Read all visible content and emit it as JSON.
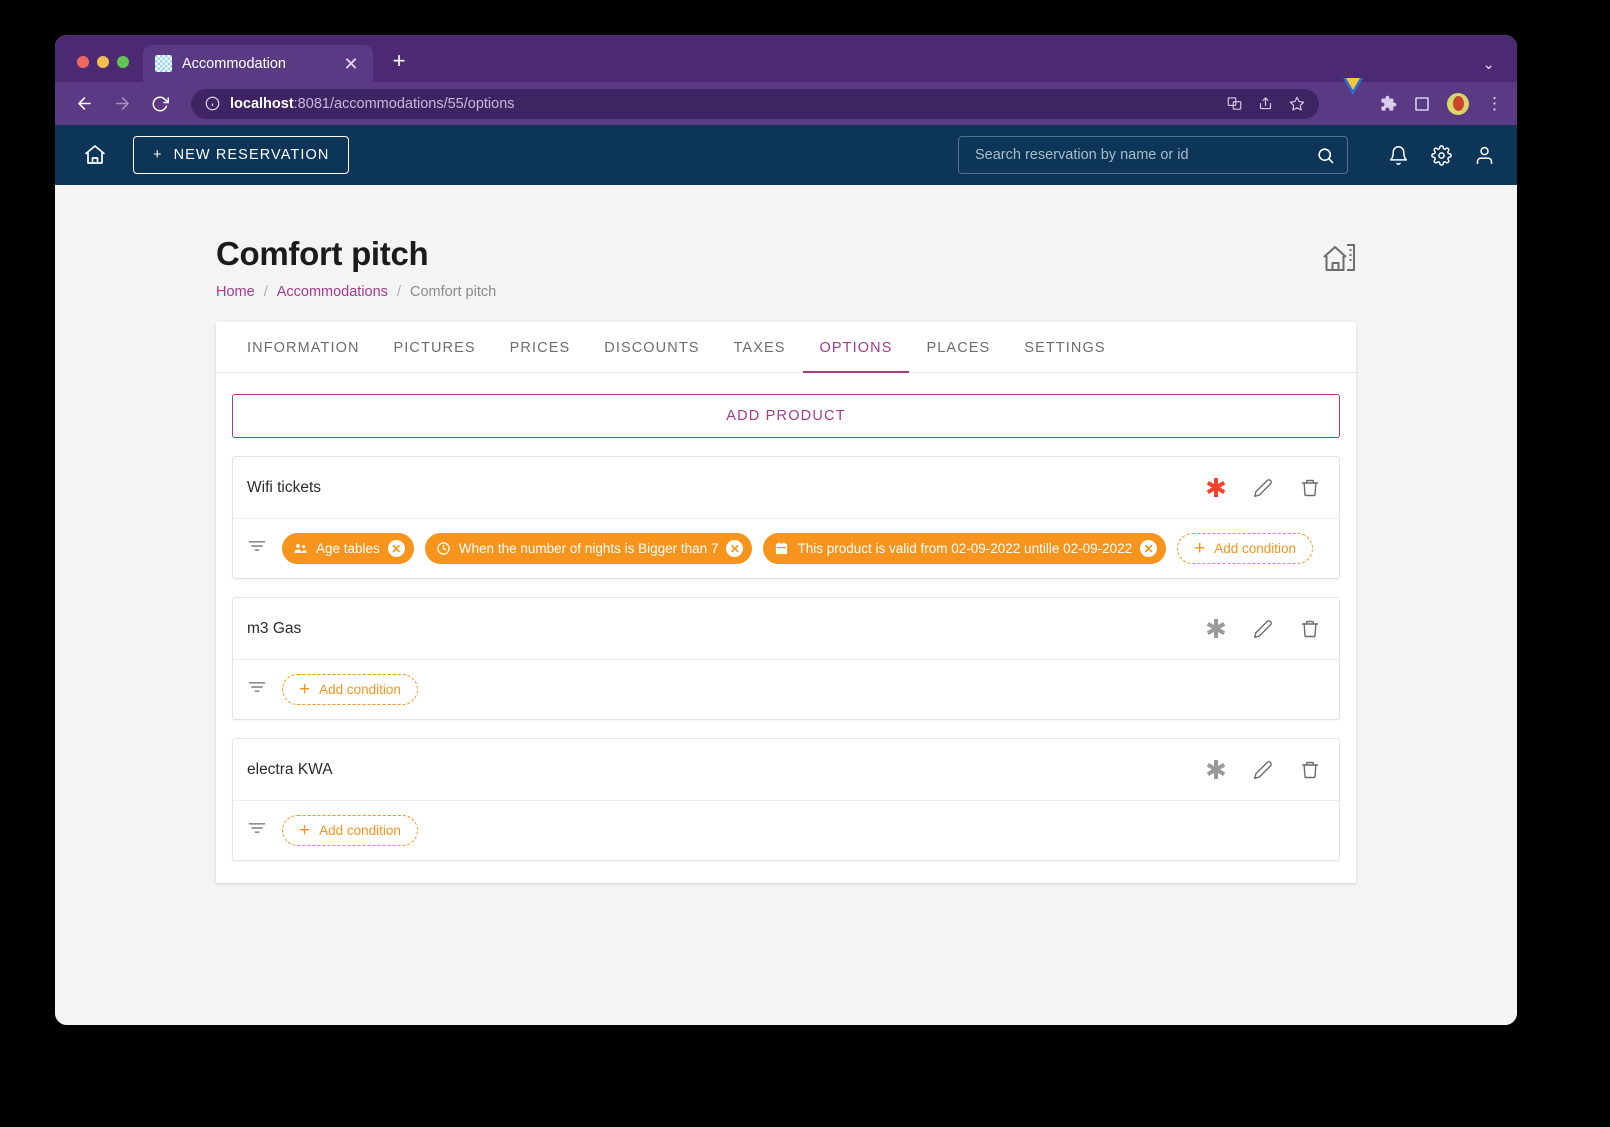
{
  "browser": {
    "tab_title": "Accommodation",
    "tab_close": "✕",
    "new_tab": "+",
    "window_chevron": "⌄",
    "url_host": "localhost",
    "url_path": ":8081/accommodations/55/options",
    "kebab": "⋮"
  },
  "app_header": {
    "new_reservation_label": "NEW RESERVATION",
    "new_reservation_plus": "+",
    "search_placeholder": "Search reservation by name or id",
    "search_value": ""
  },
  "page": {
    "title": "Comfort pitch",
    "breadcrumb": [
      {
        "label": "Home",
        "link": true
      },
      {
        "label": "Accommodations",
        "link": true
      },
      {
        "label": "Comfort pitch",
        "link": false
      }
    ],
    "breadcrumb_separator": "/"
  },
  "tabs": [
    {
      "label": "INFORMATION",
      "active": false
    },
    {
      "label": "PICTURES",
      "active": false
    },
    {
      "label": "PRICES",
      "active": false
    },
    {
      "label": "DISCOUNTS",
      "active": false
    },
    {
      "label": "TAXES",
      "active": false
    },
    {
      "label": "OPTIONS",
      "active": true
    },
    {
      "label": "PLACES",
      "active": false
    },
    {
      "label": "SETTINGS",
      "active": false
    }
  ],
  "actions": {
    "add_product_label": "ADD PRODUCT",
    "add_condition_label": "Add condition",
    "add_condition_plus": "+",
    "chip_remove": "✕"
  },
  "products": [
    {
      "name": "Wifi tickets",
      "starred": true,
      "conditions": [
        {
          "icon": "group-icon",
          "label": "Age tables"
        },
        {
          "icon": "clock-icon",
          "label": "When the number of nights is Bigger than 7"
        },
        {
          "icon": "calendar-icon",
          "label": "This product is valid from 02-09-2022 untille 02-09-2022"
        }
      ]
    },
    {
      "name": "m3 Gas",
      "starred": false,
      "conditions": []
    },
    {
      "name": "electra KWA",
      "starred": false,
      "conditions": []
    }
  ],
  "colors": {
    "browser_chrome": "#5b3a85",
    "app_header": "#0d3557",
    "accent_magenta": "#a43b8c",
    "chip_orange": "#f7941e",
    "star_active_red": "#f5422e",
    "page_background": "#f4f4f4"
  },
  "glyphs": {
    "asterisk": "✱"
  }
}
